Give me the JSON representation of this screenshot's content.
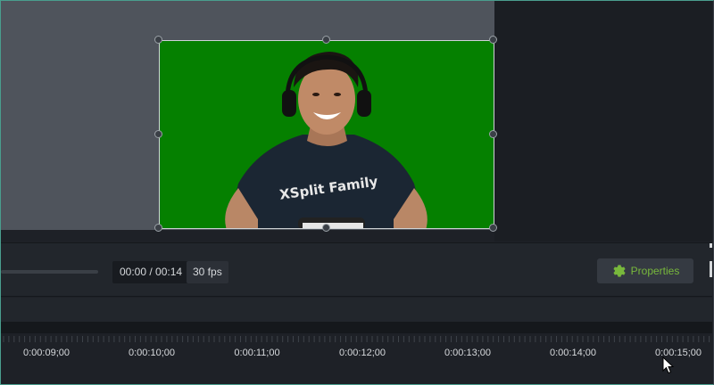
{
  "player": {
    "timecode": "00:00 / 00:14",
    "fps": "30 fps",
    "properties_label": "Properties",
    "properties_icon": "gear-icon"
  },
  "timeline": {
    "ticks": [
      "0:00:09;00",
      "0:00:10;00",
      "0:00:11;00",
      "0:00:12;00",
      "0:00:13;00",
      "0:00:14;00",
      "0:00:15;00"
    ]
  },
  "video": {
    "shirt_text": "XSplit Family"
  },
  "colors": {
    "green_screen": "#058000",
    "accent": "#78b83c"
  }
}
